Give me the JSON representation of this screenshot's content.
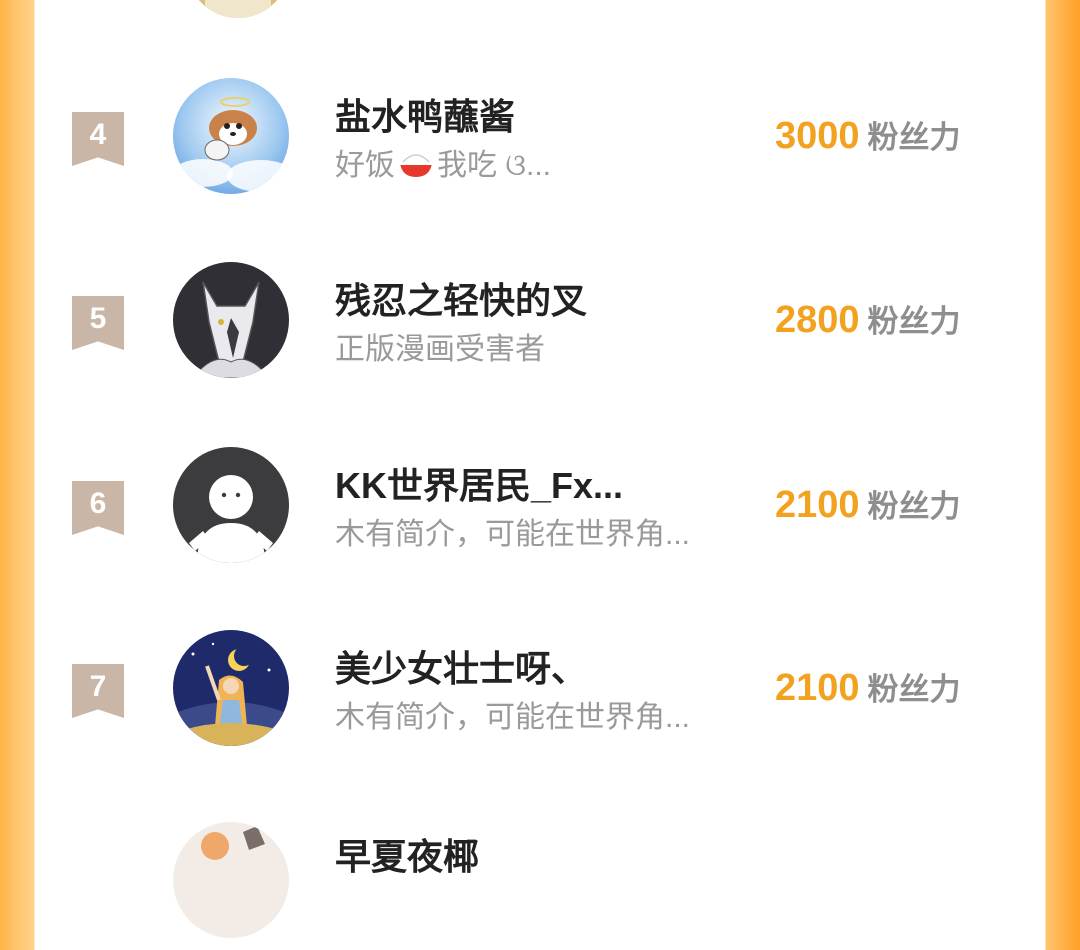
{
  "fans_unit": "粉丝力",
  "ranking": [
    {
      "rank": "4",
      "name": "盐水鸭蘸酱",
      "bio_before_emoji": "好饭",
      "bio_after_emoji": "我吃 ଓ...",
      "fans": "3000"
    },
    {
      "rank": "5",
      "name": "残忍之轻快的叉",
      "bio": "正版漫画受害者",
      "fans": "2800"
    },
    {
      "rank": "6",
      "name": "KK世界居民_Fx...",
      "bio": "木有简介，可能在世界角...",
      "fans": "2100"
    },
    {
      "rank": "7",
      "name": "美少女壮士呀、",
      "bio": "木有简介，可能在世界角...",
      "fans": "2100"
    },
    {
      "name": "早夏夜椰"
    }
  ],
  "colors": {
    "accent": "#f3a21f",
    "rank_badge": "#c9b6a6",
    "frame": "#ffa42c"
  },
  "icons": [
    "rice-bowl-emoji",
    "default-avatar-icon"
  ]
}
